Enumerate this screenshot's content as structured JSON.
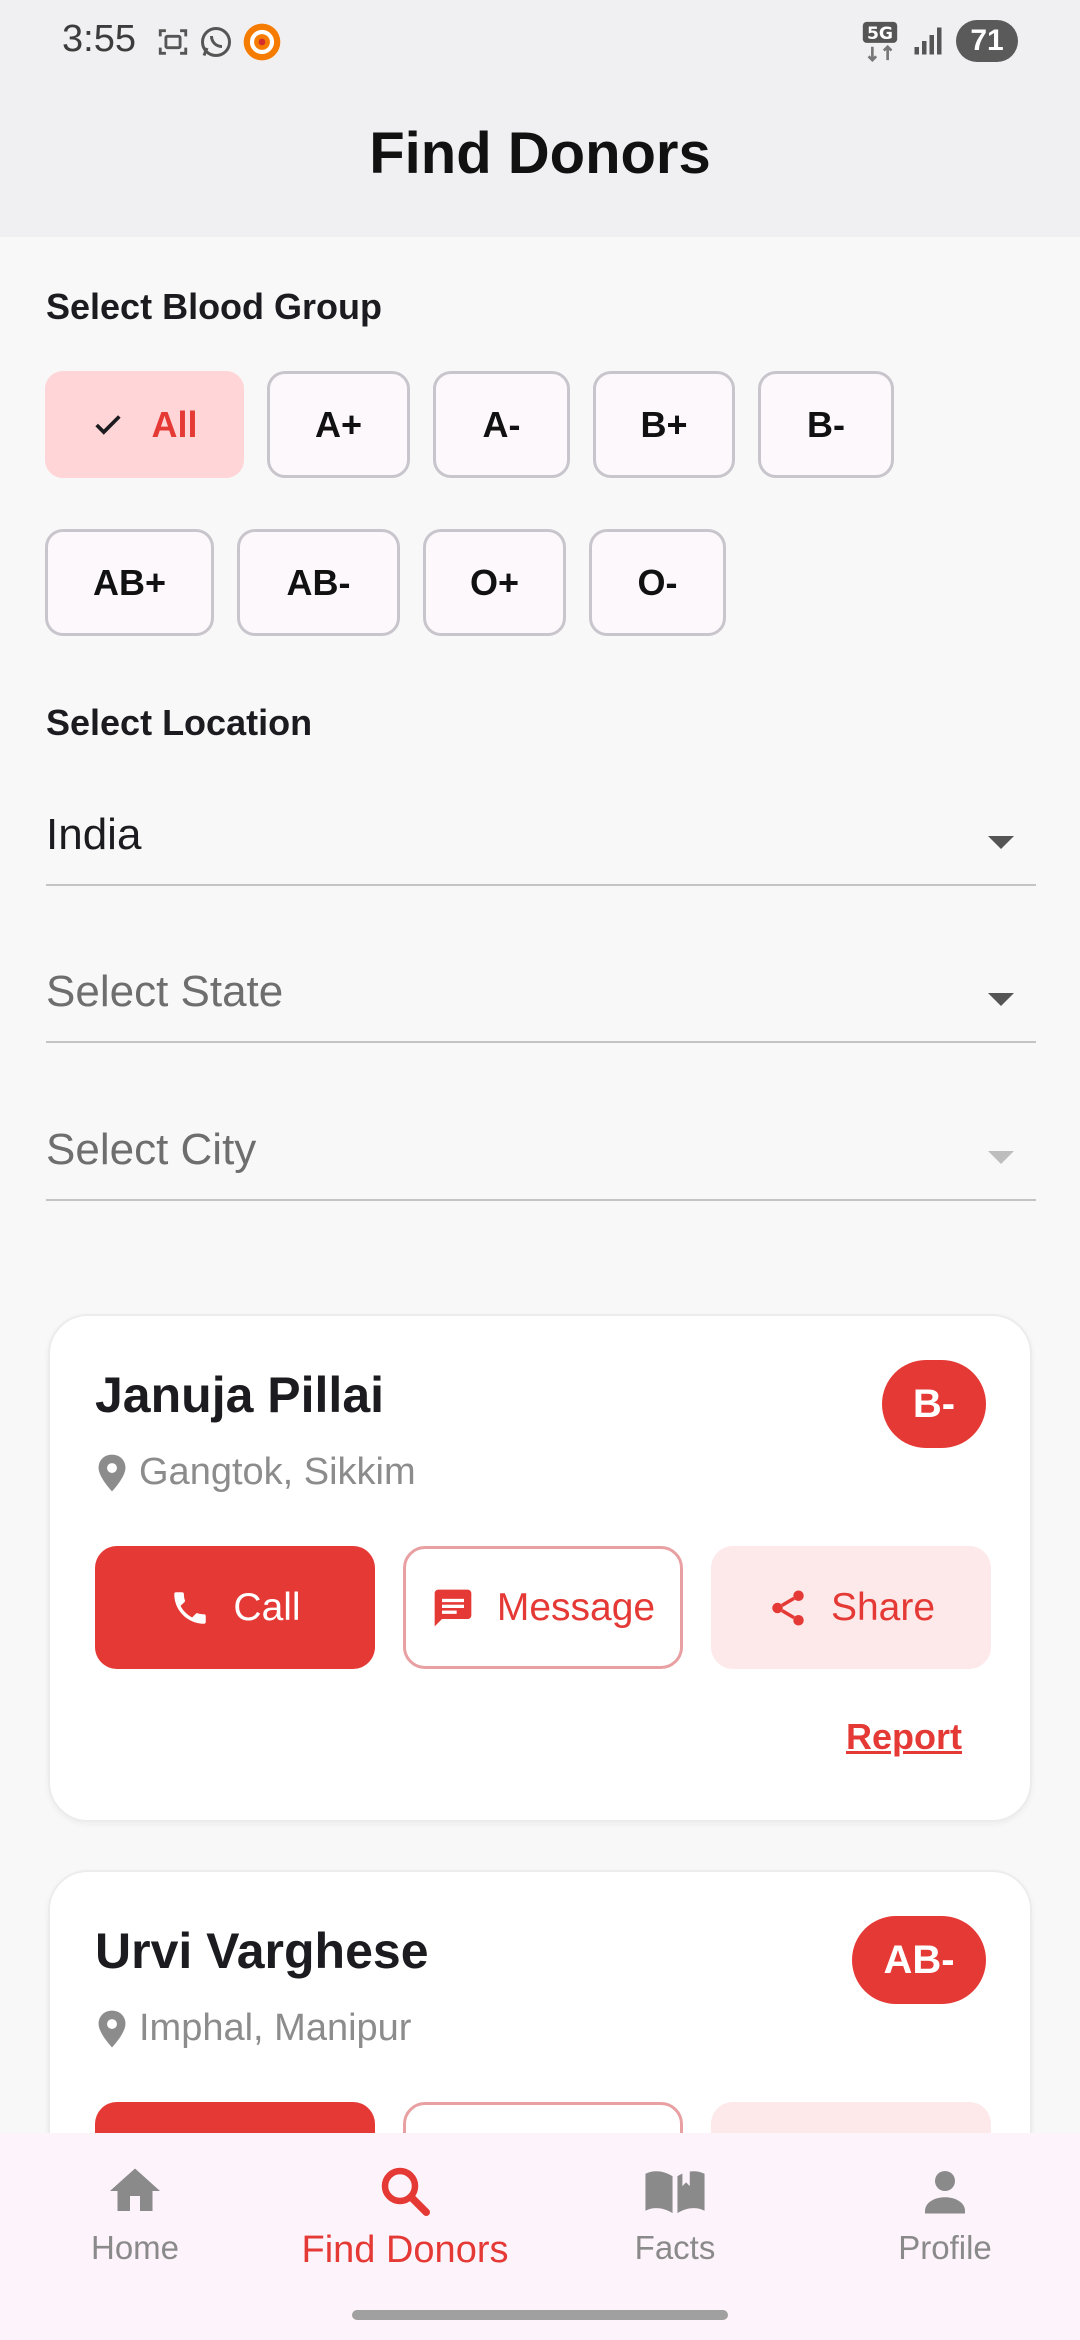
{
  "status_bar": {
    "time": "3:55",
    "network": "5G",
    "battery": "71"
  },
  "app_bar": {
    "title": "Find Donors"
  },
  "blood_group": {
    "label": "Select Blood Group",
    "options": [
      "All",
      "A+",
      "A-",
      "B+",
      "B-",
      "AB+",
      "AB-",
      "O+",
      "O-"
    ],
    "selected": "All"
  },
  "location": {
    "label": "Select Location",
    "country": {
      "value": "India"
    },
    "state": {
      "placeholder": "Select State"
    },
    "city": {
      "placeholder": "Select City"
    }
  },
  "donors": [
    {
      "name": "Januja Pillai",
      "blood_group": "B-",
      "location": "Gangtok, Sikkim",
      "call_label": "Call",
      "message_label": "Message",
      "share_label": "Share",
      "report_label": "Report"
    },
    {
      "name": "Urvi Varghese",
      "blood_group": "AB-",
      "location": "Imphal, Manipur"
    }
  ],
  "bottom_nav": {
    "items": [
      {
        "label": "Home",
        "icon": "home-icon"
      },
      {
        "label": "Find Donors",
        "icon": "search-icon"
      },
      {
        "label": "Facts",
        "icon": "book-icon"
      },
      {
        "label": "Profile",
        "icon": "person-icon"
      }
    ],
    "active": "Find Donors"
  },
  "colors": {
    "accent": "#e53935",
    "chip_selected_bg": "#ffd5d8",
    "share_bg": "#fde8ea"
  }
}
